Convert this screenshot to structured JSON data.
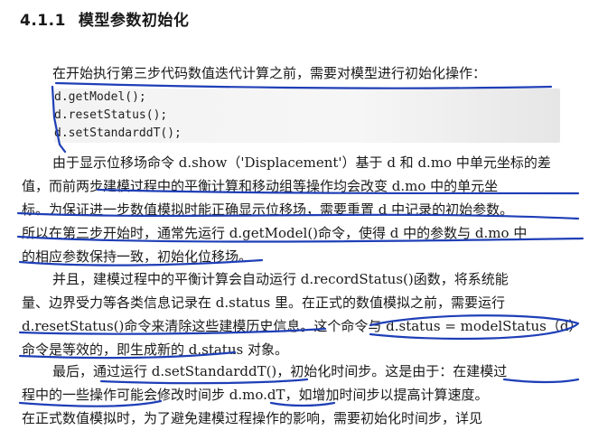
{
  "section": {
    "number": "4.1.1",
    "title": "模型参数初始化"
  },
  "intro": "在开始执行第三步代码数值迭代计算之前，需要对模型进行初始化操作：",
  "code": [
    "d.getModel();",
    "d.resetStatus();",
    "d.setStandarddT();"
  ],
  "para1": [
    "由于显示位移场命令 d.show（'Displacement'）基于 d 和 d.mo 中单元坐标的差",
    "值，而前两步建模过程中的平衡计算和移动组等操作均会改变  d.mo  中的单元坐",
    "标。为保证进一步数值模拟时能正确显示位移场，需要重置 d 中记录的初始参数。",
    "所以在第三步开始时，通常先运行 d.getModel()命令，使得 d 中的参数与 d.mo 中",
    "的相应参数保持一致，初始化位移场。"
  ],
  "para2": [
    "并且，建模过程中的平衡计算会自动运行  d.recordStatus()函数，将系统能",
    "量、边界受力等各类信息记录在  d.status  里。在正式的数值模拟之前，需要运行",
    "d.resetStatus()命令来清除这些建模历史信息。这个命令与 d.status = modelStatus（d）",
    "命令是等效的，即生成新的 d.status 对象。"
  ],
  "para3": [
    "最后，通过运行  d.setStandarddT()，初始化时间步。这是由于：在建模过",
    "程中的一些操作可能会修改时间步  d.mo.dT，如增加时间步以提高计算速度。",
    "在正式数值模拟时，为了避免建模过程操作的影响，需要初始化时间步，详见"
  ]
}
